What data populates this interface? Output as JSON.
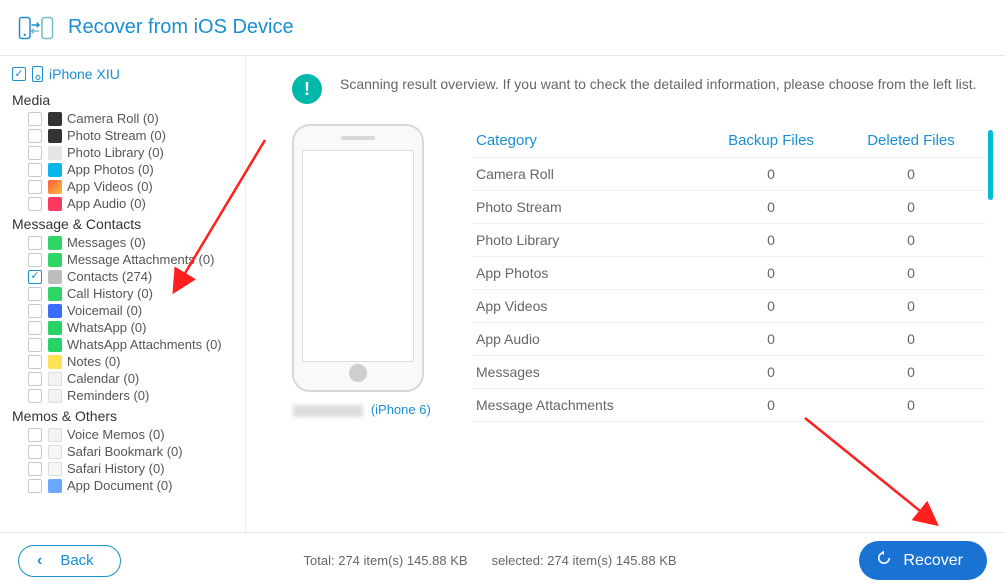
{
  "header": {
    "title": "Recover from iOS Device"
  },
  "device": {
    "name": "iPhone XIU",
    "checked": true
  },
  "sections": [
    {
      "title": "Media",
      "items": [
        {
          "icon": "camera",
          "label": "Camera Roll (0)",
          "checked": false
        },
        {
          "icon": "photostream",
          "label": "Photo Stream (0)",
          "checked": false
        },
        {
          "icon": "photolib",
          "label": "Photo Library (0)",
          "checked": false
        },
        {
          "icon": "appphotos",
          "label": "App Photos (0)",
          "checked": false
        },
        {
          "icon": "appvideos",
          "label": "App Videos (0)",
          "checked": false
        },
        {
          "icon": "appaudio",
          "label": "App Audio (0)",
          "checked": false
        }
      ]
    },
    {
      "title": "Message & Contacts",
      "items": [
        {
          "icon": "messages",
          "label": "Messages (0)",
          "checked": false
        },
        {
          "icon": "msgattach",
          "label": "Message Attachments (0)",
          "checked": false
        },
        {
          "icon": "contacts",
          "label": "Contacts (274)",
          "checked": true
        },
        {
          "icon": "callhist",
          "label": "Call History (0)",
          "checked": false
        },
        {
          "icon": "voicemail",
          "label": "Voicemail (0)",
          "checked": false
        },
        {
          "icon": "whatsapp",
          "label": "WhatsApp (0)",
          "checked": false
        },
        {
          "icon": "waattach",
          "label": "WhatsApp Attachments (0)",
          "checked": false
        },
        {
          "icon": "notes",
          "label": "Notes (0)",
          "checked": false
        },
        {
          "icon": "calendar",
          "label": "Calendar (0)",
          "checked": false
        },
        {
          "icon": "reminders",
          "label": "Reminders (0)",
          "checked": false
        }
      ]
    },
    {
      "title": "Memos & Others",
      "items": [
        {
          "icon": "voicememos",
          "label": "Voice Memos (0)",
          "checked": false
        },
        {
          "icon": "sbookmark",
          "label": "Safari Bookmark (0)",
          "checked": false
        },
        {
          "icon": "shistory",
          "label": "Safari History (0)",
          "checked": false
        },
        {
          "icon": "appdoc",
          "label": "App Document (0)",
          "checked": false
        }
      ]
    }
  ],
  "overview": {
    "text": "Scanning result overview. If you want to check the detailed information, please choose from the left list."
  },
  "phone": {
    "model": "(iPhone 6)"
  },
  "table": {
    "headers": {
      "c1": "Category",
      "c2": "Backup Files",
      "c3": "Deleted Files"
    },
    "rows": [
      {
        "c1": "Camera Roll",
        "c2": "0",
        "c3": "0"
      },
      {
        "c1": "Photo Stream",
        "c2": "0",
        "c3": "0"
      },
      {
        "c1": "Photo Library",
        "c2": "0",
        "c3": "0"
      },
      {
        "c1": "App Photos",
        "c2": "0",
        "c3": "0"
      },
      {
        "c1": "App Videos",
        "c2": "0",
        "c3": "0"
      },
      {
        "c1": "App Audio",
        "c2": "0",
        "c3": "0"
      },
      {
        "c1": "Messages",
        "c2": "0",
        "c3": "0"
      },
      {
        "c1": "Message Attachments",
        "c2": "0",
        "c3": "0"
      }
    ]
  },
  "footer": {
    "back": "Back",
    "total": "Total: 274 item(s) 145.88 KB",
    "selected": "selected: 274 item(s) 145.88 KB",
    "recover": "Recover"
  }
}
